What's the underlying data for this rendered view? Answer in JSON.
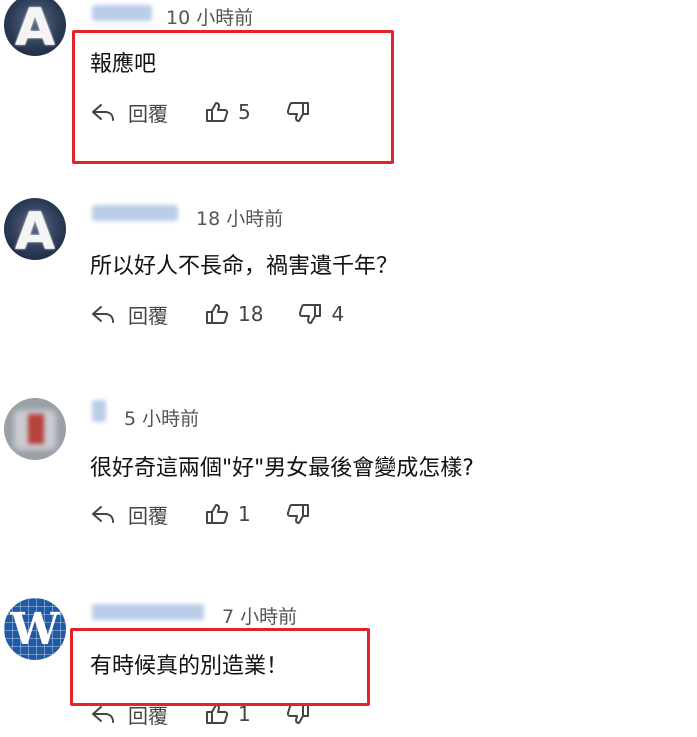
{
  "comments": [
    {
      "avatar_letter": "A",
      "time": "10 小時前",
      "text": "報應吧",
      "reply_label": "回覆",
      "likes": "5",
      "dislikes": ""
    },
    {
      "avatar_letter": "A",
      "time": "18 小時前",
      "text": "所以好人不長命，禍害遺千年？",
      "reply_label": "回覆",
      "likes": "18",
      "dislikes": "4"
    },
    {
      "avatar_letter": "",
      "time": "5 小時前",
      "text": "很好奇這兩個\"好\"男女最後會變成怎樣?",
      "reply_label": "回覆",
      "likes": "1",
      "dislikes": ""
    },
    {
      "avatar_letter": "W",
      "time": "7 小時前",
      "text": "有時候真的別造業！",
      "reply_label": "回覆",
      "likes": "1",
      "dislikes": ""
    }
  ],
  "icons": {
    "reply": "reply-arrow-icon",
    "like": "thumbs-up-icon",
    "dislike": "thumbs-down-icon"
  },
  "colors": {
    "highlight": "#e0242a",
    "name_blur": "#b9cde8"
  }
}
